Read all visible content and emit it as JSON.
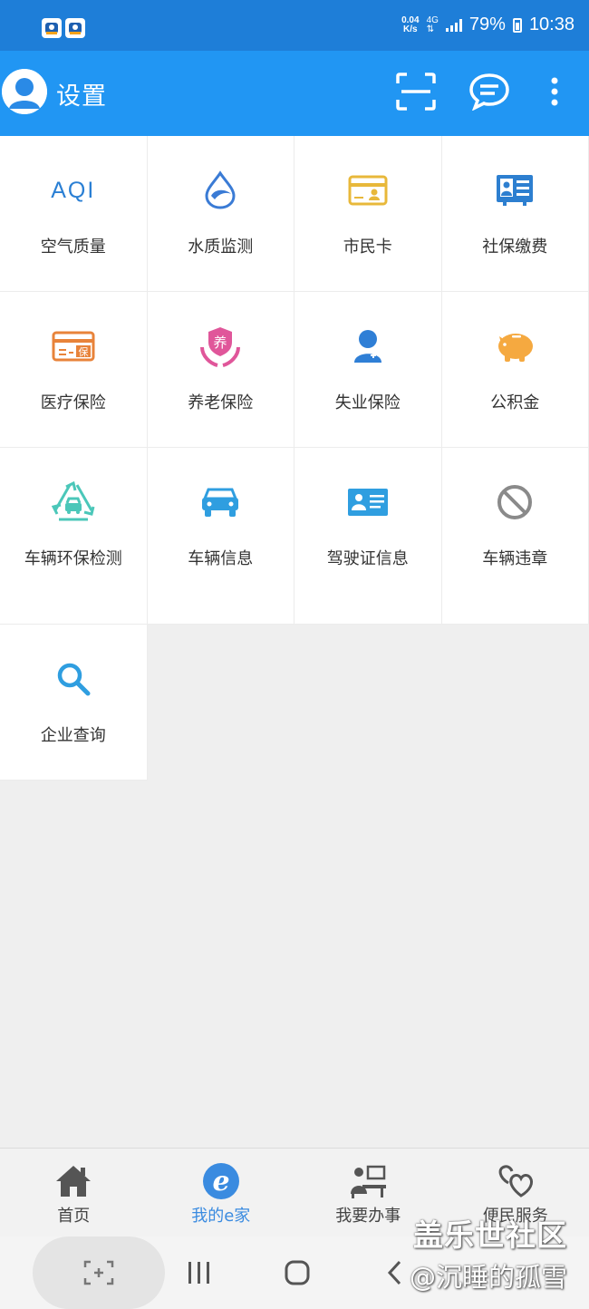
{
  "status_bar": {
    "speed_value": "0.04",
    "speed_unit": "K/s",
    "network": "4G",
    "battery": "79%",
    "time": "10:38"
  },
  "app_bar": {
    "title": "设置",
    "icons": [
      "avatar",
      "scan-icon",
      "message-icon",
      "more-vert-icon"
    ]
  },
  "services": [
    {
      "id": "aqi",
      "label": "空气质量",
      "icon": "aqi-icon",
      "icon_text": "AQI",
      "color": "#2a7fd4"
    },
    {
      "id": "water",
      "label": "水质监测",
      "icon": "water-drop-icon",
      "color": "#3a7bd5"
    },
    {
      "id": "citizen_card",
      "label": "市民卡",
      "icon": "id-card-icon",
      "color": "#e8b83a"
    },
    {
      "id": "social",
      "label": "社保缴费",
      "icon": "profile-card-icon",
      "color": "#2d7fd0"
    },
    {
      "id": "medical",
      "label": "医疗保险",
      "icon": "insurance-card-icon",
      "icon_text": "保",
      "color": "#e8833a"
    },
    {
      "id": "pension",
      "label": "养老保险",
      "icon": "pension-hands-icon",
      "icon_text": "养",
      "color": "#e0569a"
    },
    {
      "id": "unemployment",
      "label": "失业保险",
      "icon": "person-icon",
      "color": "#2f7fd6"
    },
    {
      "id": "fund",
      "label": "公积金",
      "icon": "piggy-bank-icon",
      "color": "#f5a940"
    },
    {
      "id": "vehicle_env",
      "label": "车辆环保检测",
      "icon": "recycle-car-icon",
      "color": "#4bc7b9"
    },
    {
      "id": "vehicle_info",
      "label": "车辆信息",
      "icon": "car-icon",
      "color": "#2f9ee0"
    },
    {
      "id": "license",
      "label": "驾驶证信息",
      "icon": "driver-license-icon",
      "color": "#2f9ee0"
    },
    {
      "id": "violation",
      "label": "车辆违章",
      "icon": "no-entry-icon",
      "color": "#8a8a8a"
    },
    {
      "id": "enterprise",
      "label": "企业查询",
      "icon": "search-icon",
      "color": "#2f9ee0"
    }
  ],
  "bottom_nav": [
    {
      "label": "首页",
      "icon": "home-icon",
      "active": false
    },
    {
      "label": "我的e家",
      "icon": "e-home-icon",
      "active": true
    },
    {
      "label": "我要办事",
      "icon": "office-worker-icon",
      "active": false
    },
    {
      "label": "便民服务",
      "icon": "heart-service-icon",
      "active": false
    }
  ],
  "watermark": {
    "line1": "盖乐世社区",
    "line2": "@沉睡的孤雪"
  }
}
